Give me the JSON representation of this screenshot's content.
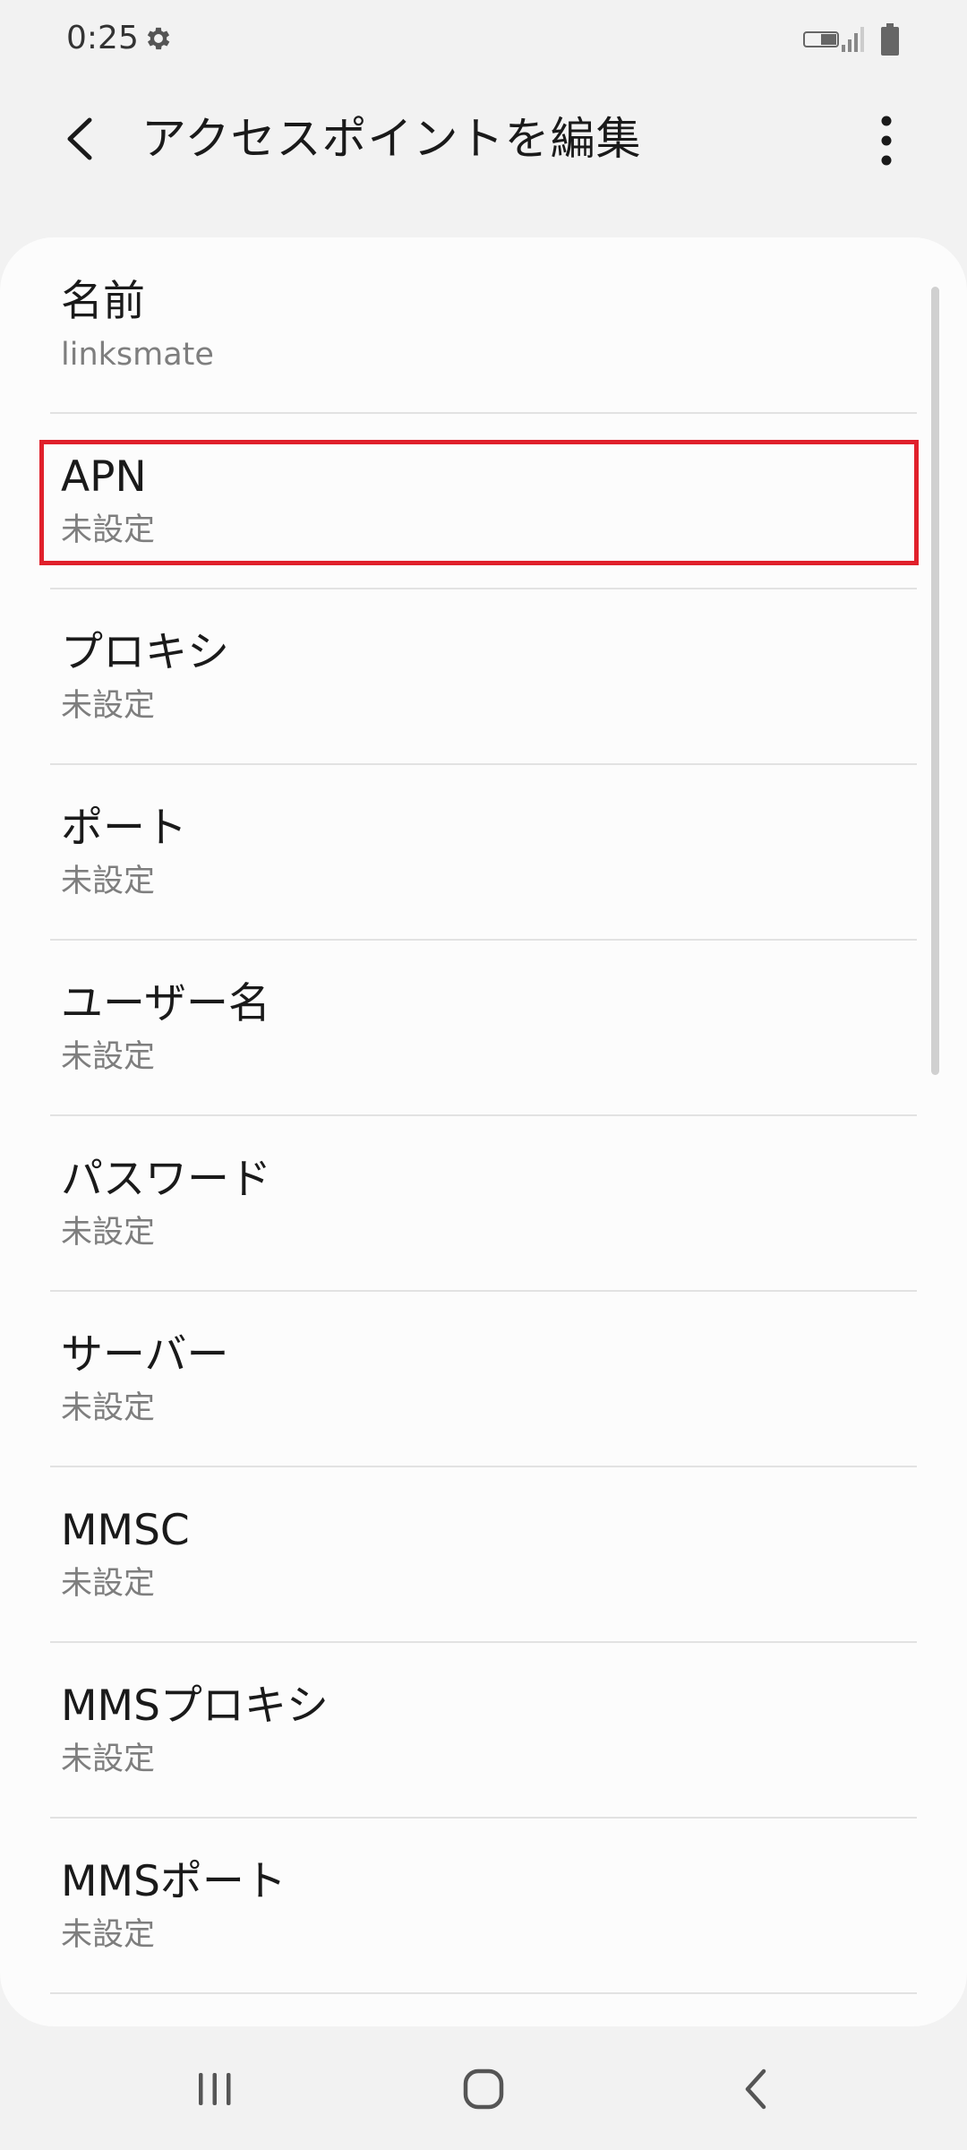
{
  "status_bar": {
    "time": "0:25",
    "icons": [
      "gear-icon",
      "volte-icon",
      "signal-icon",
      "battery-icon"
    ]
  },
  "app_bar": {
    "title": "アクセスポイントを編集",
    "icons": [
      "back-arrow-icon",
      "more-vert-icon"
    ]
  },
  "fields": [
    {
      "title": "名前",
      "summary": "linksmate"
    },
    {
      "title": "APN",
      "summary": "未設定",
      "highlighted": true
    },
    {
      "title": "プロキシ",
      "summary": "未設定"
    },
    {
      "title": "ポート",
      "summary": "未設定"
    },
    {
      "title": "ユーザー名",
      "summary": "未設定"
    },
    {
      "title": "パスワード",
      "summary": "未設定"
    },
    {
      "title": "サーバー",
      "summary": "未設定"
    },
    {
      "title": "MMSC",
      "summary": "未設定"
    },
    {
      "title": "MMSプロキシ",
      "summary": "未設定"
    },
    {
      "title": "MMSポート",
      "summary": "未設定"
    }
  ],
  "nav_bar": {
    "icons": [
      "recent-apps-icon",
      "home-icon",
      "back-icon"
    ]
  },
  "colors": {
    "background": "#f2f2f2",
    "card": "#fcfcfc",
    "highlight": "#e0202b",
    "summary_text": "#7e7e7e"
  }
}
